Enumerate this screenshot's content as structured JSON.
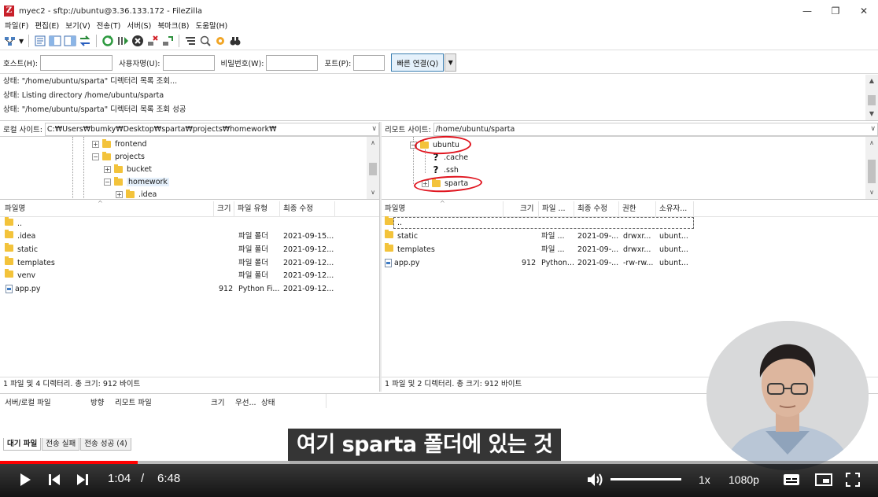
{
  "window": {
    "app_icon_letter": "Z",
    "title": "myec2 - sftp://ubuntu@3.36.133.172 - FileZilla",
    "minimize": "—",
    "maximize": "❐",
    "close": "✕"
  },
  "menu": [
    "파일(F)",
    "편집(E)",
    "보기(V)",
    "전송(T)",
    "서버(S)",
    "북마크(B)",
    "도움말(H)"
  ],
  "quickconnect": {
    "host_label": "호스트(H):",
    "user_label": "사용자명(U):",
    "pass_label": "비밀번호(W):",
    "port_label": "포트(P):",
    "connect_label": "빠른 연결(Q)",
    "host_value": "",
    "user_value": "",
    "pass_value": "",
    "port_value": ""
  },
  "log": [
    "상태:   \"/home/ubuntu/sparta\" 디렉터리 목록 조회...",
    "상태:   Listing directory /home/ubuntu/sparta",
    "상태:   \"/home/ubuntu/sparta\" 디렉터리 목록 조회 성공"
  ],
  "local": {
    "site_label": "로컬 사이트:",
    "path": "C:₩Users₩bumky₩Desktop₩sparta₩projects₩homework₩",
    "tree": [
      "frontend",
      "projects",
      "bucket",
      "homework",
      ".idea"
    ],
    "columns": [
      "파일명",
      "크기",
      "파일 유형",
      "최종 수정"
    ],
    "files": [
      {
        "name": "..",
        "size": "",
        "type": "",
        "modified": ""
      },
      {
        "name": ".idea",
        "size": "",
        "type": "파일 폴더",
        "modified": "2021-09-15..."
      },
      {
        "name": "static",
        "size": "",
        "type": "파일 폴더",
        "modified": "2021-09-12..."
      },
      {
        "name": "templates",
        "size": "",
        "type": "파일 폴더",
        "modified": "2021-09-12..."
      },
      {
        "name": "venv",
        "size": "",
        "type": "파일 폴더",
        "modified": "2021-09-12..."
      },
      {
        "name": "app.py",
        "size": "912",
        "type": "Python Fi...",
        "modified": "2021-09-12..."
      }
    ],
    "status": "1 파일 및 4 디렉터리. 총 크기: 912 바이트"
  },
  "remote": {
    "site_label": "리모트 사이트:",
    "path": "/home/ubuntu/sparta",
    "tree": [
      "ubuntu",
      ".cache",
      ".ssh",
      "sparta"
    ],
    "columns": [
      "파일명",
      "크기",
      "파일 ...",
      "최종 수정",
      "권한",
      "소유자..."
    ],
    "files": [
      {
        "name": "..",
        "size": "",
        "type": "",
        "modified": "",
        "perm": "",
        "owner": ""
      },
      {
        "name": "static",
        "size": "",
        "type": "파일 ...",
        "modified": "2021-09-...",
        "perm": "drwxr...",
        "owner": "ubunt..."
      },
      {
        "name": "templates",
        "size": "",
        "type": "파일 ...",
        "modified": "2021-09-...",
        "perm": "drwxr...",
        "owner": "ubunt..."
      },
      {
        "name": "app.py",
        "size": "912",
        "type": "Python...",
        "modified": "2021-09-...",
        "perm": "-rw-rw...",
        "owner": "ubunt..."
      }
    ],
    "status": "1 파일 및 2 디렉터리. 총 크기: 912 바이트"
  },
  "queue": {
    "columns": [
      "서버/로컬 파일",
      "방향",
      "리모트 파일",
      "크기",
      "우선...",
      "상태"
    ],
    "tabs": [
      "대기 파일",
      "전송 실패",
      "전송 성공 (4)"
    ]
  },
  "video": {
    "caption": "여기 sparta 폴더에 있는 것",
    "current_time": "1:04",
    "separator": "/",
    "duration": "6:48",
    "speed": "1x",
    "quality": "1080p",
    "played_fraction": 0.157,
    "buffered_fraction": 0.33,
    "volume_fraction": 1.0
  },
  "colors": {
    "annotation": "#e0141e",
    "progress": "#ff0000",
    "folder": "#f3c33b",
    "quickconnect_border": "#3c7fb1"
  }
}
